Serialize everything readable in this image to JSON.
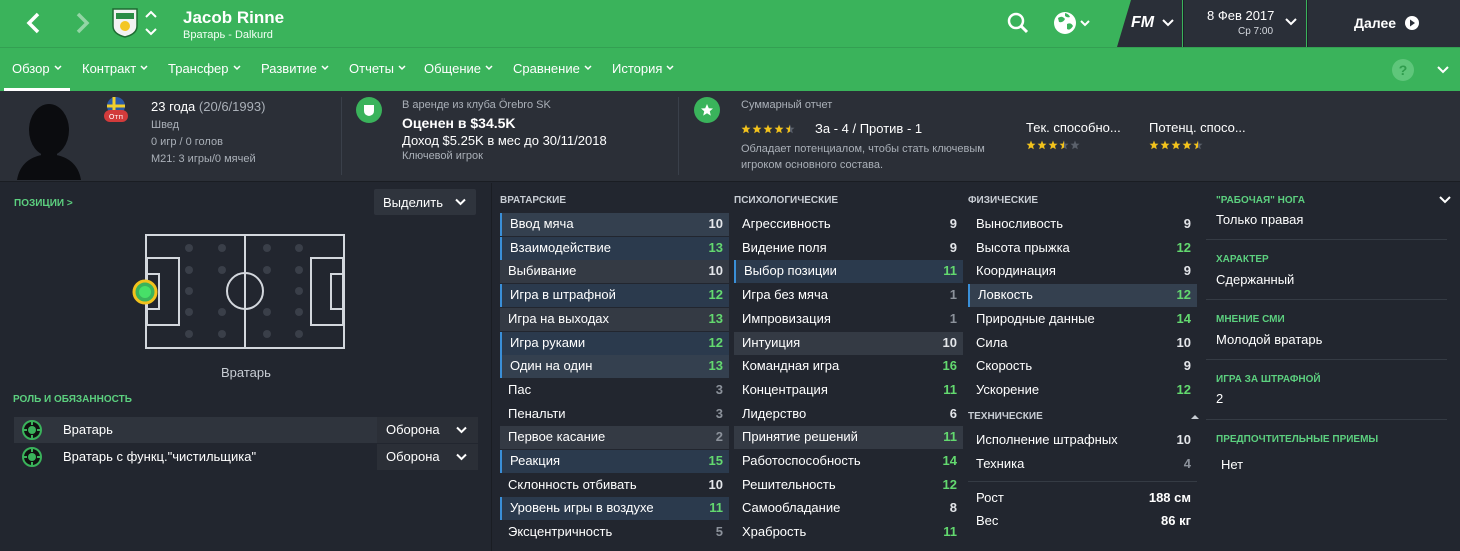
{
  "header": {
    "player_name": "Jacob Rinne",
    "subtitle": "Вратарь - Dalkurd",
    "fm_label": "FM",
    "date": "8 Фев 2017",
    "time": "Ср 7:00",
    "continue_label": "Далее",
    "accent": "#3ab35b"
  },
  "tabs": [
    {
      "label": "Обзор"
    },
    {
      "label": "Контракт"
    },
    {
      "label": "Трансфер"
    },
    {
      "label": "Развитие"
    },
    {
      "label": "Отчеты"
    },
    {
      "label": "Общение"
    },
    {
      "label": "Сравнение"
    },
    {
      "label": "История"
    }
  ],
  "help_label": "?",
  "profile": {
    "flag_text": "Отп",
    "age": "23 года",
    "dob": "(20/6/1993)",
    "nationality": "Швед",
    "caps": "0 игр / 0 голов",
    "u21": "M21: 3 игры/0 мячей"
  },
  "contract": {
    "loan": "В аренде из клуба Örebro SK",
    "value": "Оценен в $34.5K",
    "wage": "Доход $5.25K в мес до 30/11/2018",
    "status": "Ключевой игрок"
  },
  "report": {
    "title": "Суммарный отчет",
    "stars": 4.5,
    "pros_cons": "За - 4 / Против - 1",
    "summary_line1": "Обладает потенциалом, чтобы стать ключевым",
    "summary_line2": "игроком основного состава.",
    "current_label": "Тек. способно...",
    "current_stars": 3.5,
    "potential_label": "Потенц. спосо...",
    "potential_stars": 4.5
  },
  "positions": {
    "title": "ПОЗИЦИИ >",
    "highlight_label": "Выделить",
    "position_label": "Вратарь"
  },
  "roles": {
    "title": "РОЛЬ И ОБЯЗАННОСТЬ",
    "items": [
      {
        "name": "Вратарь",
        "duty": "Оборона"
      },
      {
        "name": "Вратарь с функц.\"чистильщика\"",
        "duty": "Оборона"
      }
    ]
  },
  "attributes": {
    "goalkeeping": {
      "title": "ВРАТАРСКИЕ",
      "items": [
        {
          "name": "Ввод мяча",
          "value": "10"
        },
        {
          "name": "Взаимодействие",
          "value": "13"
        },
        {
          "name": "Выбивание",
          "value": "10"
        },
        {
          "name": "Игра в штрафной",
          "value": "12"
        },
        {
          "name": "Игра на выходах",
          "value": "13"
        },
        {
          "name": "Игра руками",
          "value": "12"
        },
        {
          "name": "Один на один",
          "value": "13"
        },
        {
          "name": "Пас",
          "value": "3"
        },
        {
          "name": "Пенальти",
          "value": "3"
        },
        {
          "name": "Первое касание",
          "value": "2"
        },
        {
          "name": "Реакция",
          "value": "15"
        },
        {
          "name": "Склонность отбивать",
          "value": "10"
        },
        {
          "name": "Уровень игры в воздухе",
          "value": "11"
        },
        {
          "name": "Эксцентричность",
          "value": "5"
        }
      ]
    },
    "mental": {
      "title": "ПСИХОЛОГИЧЕСКИЕ",
      "items": [
        {
          "name": "Агрессивность",
          "value": "9"
        },
        {
          "name": "Видение поля",
          "value": "9"
        },
        {
          "name": "Выбор позиции",
          "value": "11"
        },
        {
          "name": "Игра без мяча",
          "value": "1"
        },
        {
          "name": "Импровизация",
          "value": "1"
        },
        {
          "name": "Интуиция",
          "value": "10"
        },
        {
          "name": "Командная игра",
          "value": "16"
        },
        {
          "name": "Концентрация",
          "value": "11"
        },
        {
          "name": "Лидерство",
          "value": "6"
        },
        {
          "name": "Принятие решений",
          "value": "11"
        },
        {
          "name": "Работоспособность",
          "value": "14"
        },
        {
          "name": "Решительность",
          "value": "12"
        },
        {
          "name": "Самообладание",
          "value": "8"
        },
        {
          "name": "Храбрость",
          "value": "11"
        }
      ]
    },
    "physical": {
      "title": "ФИЗИЧЕСКИЕ",
      "items": [
        {
          "name": "Выносливость",
          "value": "9"
        },
        {
          "name": "Высота прыжка",
          "value": "12"
        },
        {
          "name": "Координация",
          "value": "9"
        },
        {
          "name": "Ловкость",
          "value": "12"
        },
        {
          "name": "Природные данные",
          "value": "14"
        },
        {
          "name": "Сила",
          "value": "10"
        },
        {
          "name": "Скорость",
          "value": "9"
        },
        {
          "name": "Ускорение",
          "value": "12"
        }
      ]
    },
    "technical": {
      "title": "ТЕХНИЧЕСКИЕ",
      "items": [
        {
          "name": "Исполнение штрафных",
          "value": "10"
        },
        {
          "name": "Техника",
          "value": "4"
        }
      ]
    },
    "body": [
      {
        "name": "Рост",
        "value": "188 см"
      },
      {
        "name": "Вес",
        "value": "86 кг"
      }
    ]
  },
  "sidebar": {
    "items": [
      {
        "label": "\"РАБОЧАЯ\" НОГА",
        "value": "Только правая"
      },
      {
        "label": "ХАРАКТЕР",
        "value": "Сдержанный"
      },
      {
        "label": "МНЕНИЕ СМИ",
        "value": "Молодой вратарь"
      },
      {
        "label": "ИГРА ЗА ШТРАФНОЙ",
        "value": "2"
      },
      {
        "label": "ПРЕДПОЧТИТЕЛЬНЫЕ ПРИЕМЫ",
        "value": "Нет"
      }
    ]
  }
}
